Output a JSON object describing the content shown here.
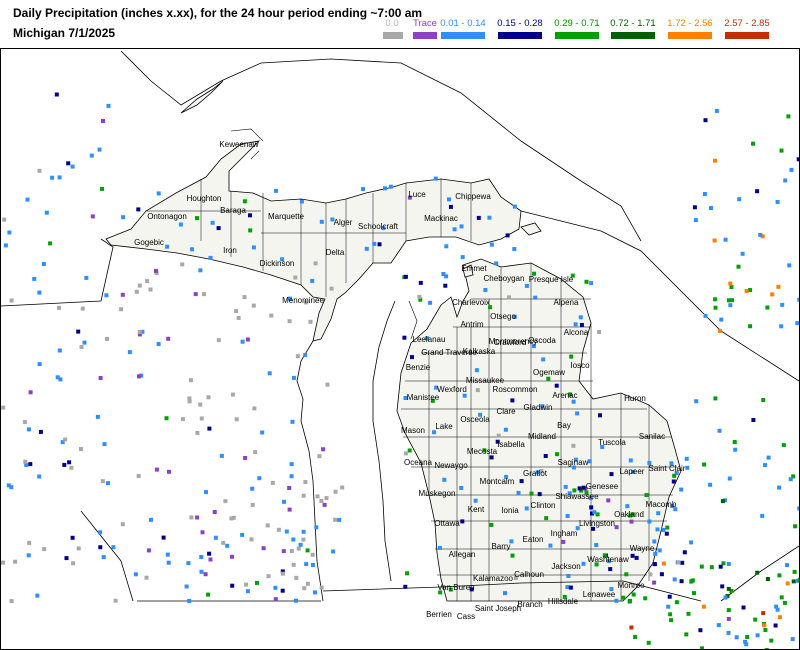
{
  "title": "Daily Precipitation (inches  x.xx),  for the 24 hour period ending ~7:00 am",
  "subtitle": "Michigan 7/1/2025",
  "legend": [
    {
      "label": "0.0",
      "color": "#a8a8a8",
      "text_color": "#b8b8b8"
    },
    {
      "label": "Trace",
      "color": "#8c3fc8",
      "text_color": "#8c3fc8"
    },
    {
      "label": "0.01 - 0.14",
      "color": "#2f8fff",
      "text_color": "#2f8fff"
    },
    {
      "label": "0.15 - 0.28",
      "color": "#00008c",
      "text_color": "#00008c"
    },
    {
      "label": "0.29 - 0.71",
      "color": "#00a000",
      "text_color": "#009000"
    },
    {
      "label": "0.72 - 1.71",
      "color": "#006000",
      "text_color": "#006000"
    },
    {
      "label": "1.72 - 2.56",
      "color": "#ff7f00",
      "text_color": "#ff7f00"
    },
    {
      "label": "2.57 - 2.85",
      "color": "#c03000",
      "text_color": "#c03000"
    }
  ],
  "counties": [
    "Keweenaw",
    "Houghton",
    "Baraga",
    "Ontonagon",
    "Gogebic",
    "Iron",
    "Marquette",
    "Dickinson",
    "Alger",
    "Schoolcraft",
    "Delta",
    "Menominee",
    "Luce",
    "Chippewa",
    "Mackinac",
    "Emmet",
    "Cheboygan",
    "Presque Isle",
    "Charlevoix",
    "Antrim",
    "Otsego",
    "Montmorency",
    "Alpena",
    "Leelanau",
    "Kalkaska",
    "Crawford",
    "Oscoda",
    "Alcona",
    "Benzie",
    "Grand Traverse",
    "Wexford",
    "Missaukee",
    "Roscommon",
    "Ogemaw",
    "Iosco",
    "Manistee",
    "Arenac",
    "Huron",
    "Mason",
    "Lake",
    "Osceola",
    "Clare",
    "Gladwin",
    "Bay",
    "Tuscola",
    "Sanilac",
    "Oceana",
    "Newaygo",
    "Mecosta",
    "Isabella",
    "Midland",
    "Saginaw",
    "Lapeer",
    "Saint Clair",
    "Muskegon",
    "Montcalm",
    "Gratiot",
    "Genesee",
    "Macomb",
    "Ottawa",
    "Kent",
    "Ionia",
    "Clinton",
    "Shiawassee",
    "Oakland",
    "Livingston",
    "Allegan",
    "Barry",
    "Eaton",
    "Ingham",
    "Wayne",
    "Van Buren",
    "Kalamazoo",
    "Calhoun",
    "Jackson",
    "Washtenaw",
    "Monroe",
    "Berrien",
    "Cass",
    "Saint Joseph",
    "Branch",
    "Hillsdale",
    "Lenawee"
  ]
}
